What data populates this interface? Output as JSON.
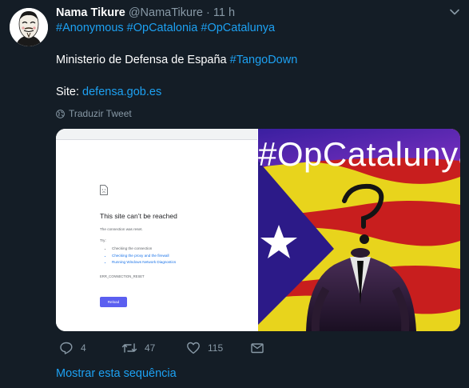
{
  "tweet": {
    "author_name": "Nama Tikure",
    "handle": "@NamaTikure",
    "separator": "·",
    "time": "11 h",
    "hashtags": [
      "#Anonymous",
      "#OpCatalonia",
      "#OpCatalunya"
    ],
    "line2_text": "Ministerio de Defensa de España",
    "line2_hashtag": "#TangoDown",
    "site_label": "Site:",
    "site_link": "defensa.gob.es",
    "translate_label": "Traduzir Tweet"
  },
  "media": {
    "left_screenshot": {
      "title": "This site can’t be reached",
      "subtitle": "The connection was reset.",
      "try_label": "Try:",
      "suggestions": [
        "Checking the connection",
        "Checking the proxy and the firewall",
        "Running Windows Network Diagnostics"
      ],
      "error_code": "ERR_CONNECTION_RESET",
      "reload_label": "Reload"
    },
    "right_image": {
      "title": "#OpCatalunya"
    }
  },
  "actions": {
    "replies": "4",
    "retweets": "47",
    "likes": "115"
  },
  "footer": {
    "show_thread": "Mostrar esta sequência"
  },
  "colors": {
    "background": "#141d26",
    "link": "#1da1f2",
    "muted": "#8899a6"
  }
}
